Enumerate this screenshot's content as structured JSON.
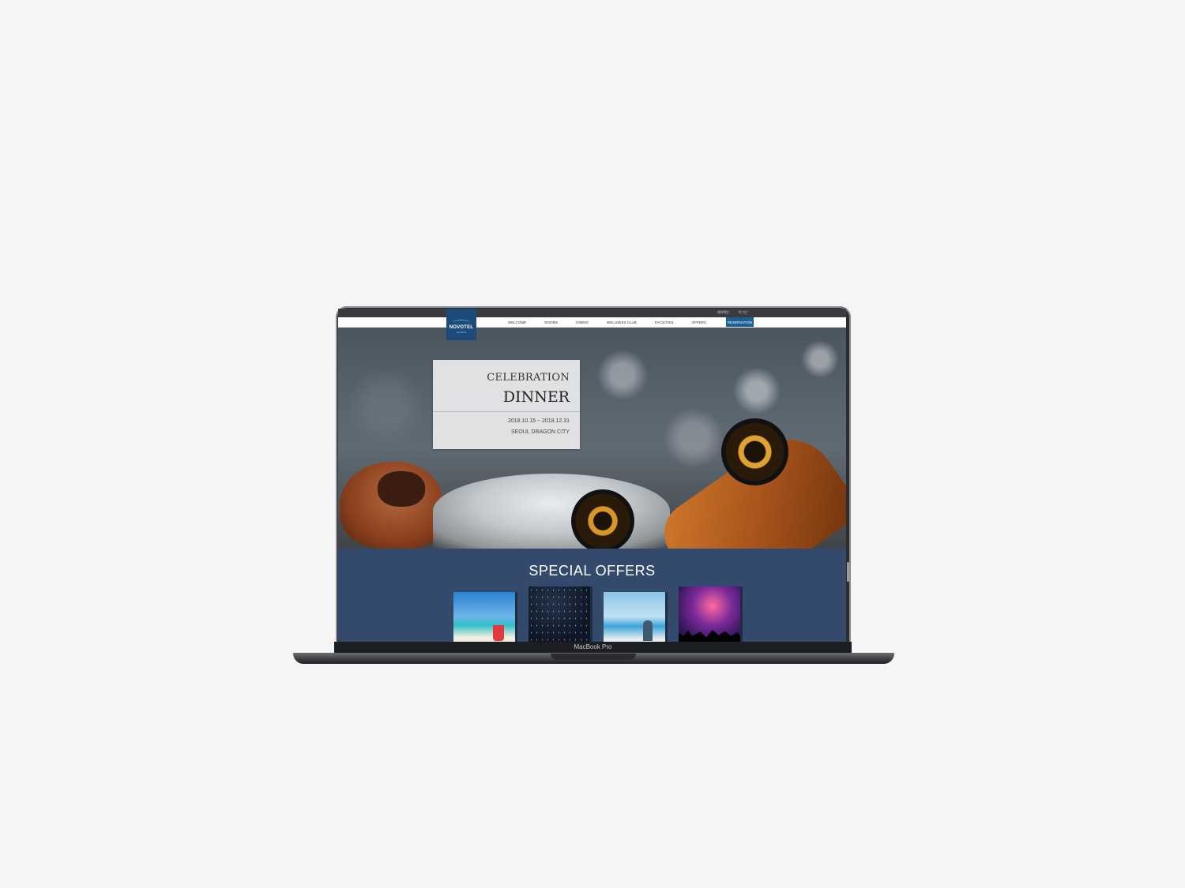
{
  "device": {
    "model_label": "MacBook Pro"
  },
  "top_links": [
    "예약확인",
    "로그인"
  ],
  "brand": {
    "logo_text": "NOVOTEL",
    "logo_sub": "HOTELS"
  },
  "nav": {
    "items": [
      "WELCOME",
      "ROOMS",
      "DINING",
      "WELLNESS CLUB",
      "FACILITIES",
      "OFFERS"
    ],
    "reserve_label": "RESERVATION"
  },
  "hero": {
    "kicker": "CELEBRATION",
    "title": "DINNER",
    "dates": "2018.10.15 ~ 2018.12.31",
    "venue": "SEOUL DRAGON CITY"
  },
  "offers": {
    "title": "SPECIAL OFFERS",
    "thumbnails": [
      "tropical-drink-image",
      "starry-sky-image",
      "beach-person-image",
      "concert-crowd-image"
    ]
  },
  "colors": {
    "brand_blue": "#1c4b7a",
    "reserve_blue": "#1e5f92",
    "offers_bg": "#344a6c",
    "page_bg": "#f5f5f5"
  }
}
